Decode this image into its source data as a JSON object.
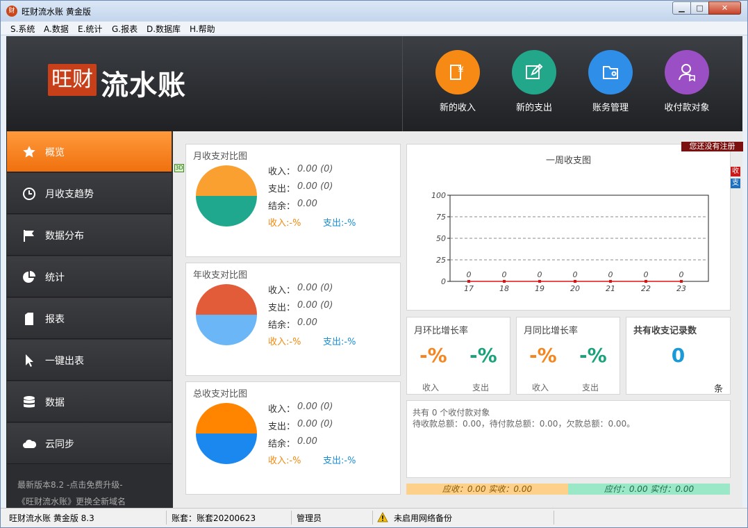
{
  "window": {
    "title": "旺财流水账 黄金版",
    "icon_char": "财"
  },
  "menu": [
    "S.系统",
    "A.数据",
    "E.统计",
    "G.报表",
    "D.数据库",
    "H.帮助"
  ],
  "header": {
    "logo_mark": "旺财",
    "logo_text": "流水账",
    "buttons": [
      {
        "label": "新的收入",
        "icon": "yuan-receipt-icon",
        "color": "#f68a14"
      },
      {
        "label": "新的支出",
        "icon": "pencil-edit-icon",
        "color": "#22a78a"
      },
      {
        "label": "账务管理",
        "icon": "wallet-icon",
        "color": "#2f8fe8"
      },
      {
        "label": "收付款对象",
        "icon": "person-icon",
        "color": "#9a4fc4"
      }
    ]
  },
  "sidebar": {
    "items": [
      {
        "label": "概览",
        "icon": "star-icon",
        "active": true
      },
      {
        "label": "月收支趋势",
        "icon": "clock-icon",
        "active": false
      },
      {
        "label": "数据分布",
        "icon": "flag-icon",
        "active": false
      },
      {
        "label": "统计",
        "icon": "pie-icon",
        "active": false
      },
      {
        "label": "报表",
        "icon": "document-icon",
        "active": false
      },
      {
        "label": "一键出表",
        "icon": "cursor-icon",
        "active": false
      },
      {
        "label": "数据",
        "icon": "database-icon",
        "active": false
      },
      {
        "label": "云同步",
        "icon": "cloud-icon",
        "active": false
      }
    ],
    "footer": [
      "最新版本8.2 -点击免费升级-",
      "《旺财流水账》更换全新域名"
    ]
  },
  "badge_3d": "3D",
  "pies": [
    {
      "title": "月收支对比图",
      "income_label": "收入：",
      "income": "0.00 (0)",
      "expense_label": "支出：",
      "expense": "0.00 (0)",
      "balance_label": "结余：",
      "balance": "0.00",
      "pct_in": "收入:-%",
      "pct_out": "支出:-%",
      "color_top": "#f9a030",
      "color_bottom": "#20a88e"
    },
    {
      "title": "年收支对比图",
      "income_label": "收入：",
      "income": "0.00 (0)",
      "expense_label": "支出：",
      "expense": "0.00 (0)",
      "balance_label": "结余：",
      "balance": "0.00",
      "pct_in": "收入:-%",
      "pct_out": "支出:-%",
      "color_top": "#e25c3a",
      "color_bottom": "#6ab6f6"
    },
    {
      "title": "总收支对比图",
      "income_label": "收入：",
      "income": "0.00 (0)",
      "expense_label": "支出：",
      "expense": "0.00 (0)",
      "balance_label": "结余：",
      "balance": "0.00",
      "pct_in": "收入:-%",
      "pct_out": "支出:-%",
      "color_top": "#ff8400",
      "color_bottom": "#1b88f0"
    }
  ],
  "chart_data": {
    "type": "line",
    "title": "一周收支图",
    "categories": [
      "17",
      "18",
      "19",
      "20",
      "21",
      "22",
      "23"
    ],
    "series": [
      {
        "name": "收",
        "values": [
          0,
          0,
          0,
          0,
          0,
          0,
          0
        ],
        "color": "#e01010"
      }
    ],
    "data_labels": [
      "0",
      "0",
      "0",
      "0",
      "0",
      "0",
      "0"
    ],
    "ylim": [
      0,
      100
    ],
    "yticks": [
      0,
      25,
      50,
      75,
      100
    ],
    "grid": true,
    "legend": [
      "收",
      "支"
    ],
    "legend_colors": [
      "#cc1818",
      "#1d6fc0"
    ]
  },
  "register_banner": "您还没有注册",
  "stats": {
    "month_ring": {
      "title": "月环比增长率",
      "in_value": "-%",
      "out_value": "-%",
      "in_label": "收入",
      "out_label": "支出"
    },
    "month_yoy": {
      "title": "月同比增长率",
      "in_value": "-%",
      "out_value": "-%",
      "in_label": "收入",
      "out_label": "支出"
    },
    "records": {
      "title": "共有收支记录数",
      "count": "0",
      "unit": "条"
    }
  },
  "summary": {
    "line1": "共有 0 个收付款对象",
    "line2": "待收款总额：0.00，待付款总额：0.00，欠款总额：0.00。"
  },
  "bottom_bars": {
    "receivable": "应收：0.00 实收：0.00",
    "payable": "应付：0.00 实付：0.00"
  },
  "status": {
    "app": "旺财流水账 黄金版 8.3",
    "account": "账套：账套20200623",
    "user": "管理员",
    "backup": "未启用网络备份"
  }
}
